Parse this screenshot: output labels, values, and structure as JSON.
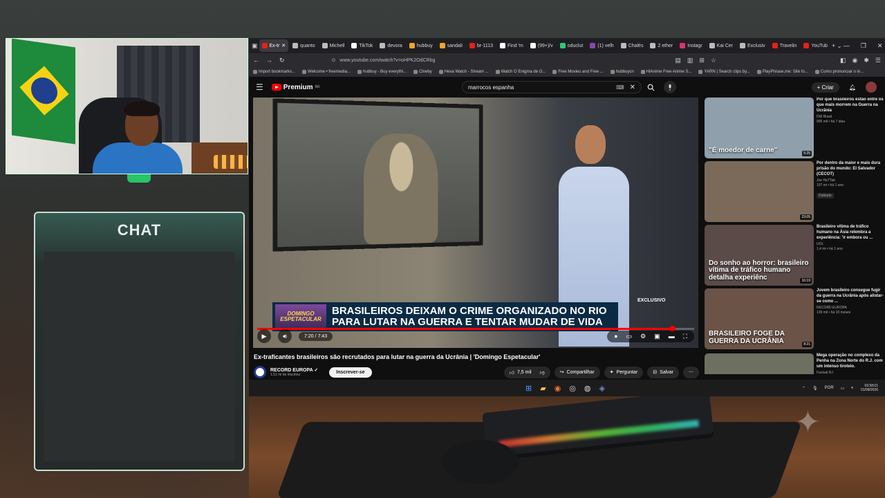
{
  "chat": {
    "title": "CHAT"
  },
  "browser": {
    "tabs": [
      {
        "label": "Ex-tr",
        "color": "#e62117",
        "active": true
      },
      {
        "label": "quanto",
        "color": "#bbbbbb"
      },
      {
        "label": "Michell",
        "color": "#bbbbbb"
      },
      {
        "label": "TikTok",
        "color": "#ffffff"
      },
      {
        "label": "devora",
        "color": "#bbbbbb"
      },
      {
        "label": "hubbuy",
        "color": "#f5a623"
      },
      {
        "label": "sandali",
        "color": "#f5a623"
      },
      {
        "label": "br-1113",
        "color": "#e62117"
      },
      {
        "label": "Find 'm",
        "color": "#ffffff"
      },
      {
        "label": "(99+)/v",
        "color": "#ffffff"
      },
      {
        "label": "oduclut",
        "color": "#2ecc71"
      },
      {
        "label": "(1) velh",
        "color": "#8e44ad"
      },
      {
        "label": "Chalés",
        "color": "#bbbbbb"
      },
      {
        "label": "2 ether",
        "color": "#bbbbbb"
      },
      {
        "label": "Instagr",
        "color": "#e1306c"
      },
      {
        "label": "Kai Cer",
        "color": "#bbbbbb"
      },
      {
        "label": "Exclusiv",
        "color": "#bbbbbb"
      },
      {
        "label": "Travelin",
        "color": "#e62117"
      },
      {
        "label": "YouTub",
        "color": "#e62117"
      }
    ],
    "url": "www.youtube.com/watch?v=oHPK2OdCRbg",
    "bookmarks": [
      "Import bookmarks...",
      "Welcome • freemedia...",
      "hubbuy - Buy everythi...",
      "Cineby",
      "Hexa Watch - Stream ...",
      "Watch O Enigma de O...",
      "Free Movies and Free ...",
      "hubbuycn",
      "HiAnime Free Anime S...",
      "YARN | Search clips by...",
      "PlayPhrase.me: Site fo...",
      "Como pronunciar o in..."
    ]
  },
  "youtube": {
    "logo_text": "Premium",
    "logo_sup": "BR",
    "search_value": "marrocos espanha",
    "create_label": "Criar",
    "video": {
      "banner_logo_line1": "DOMINGO",
      "banner_logo_line2": "ESPETACULAR",
      "banner_line1": "BRASILEIROS DEIXAM O CRIME ORGANIZADO NO RIO",
      "banner_line2": "PARA LUTAR NA GUERRA E TENTAR MUDAR DE VIDA",
      "exclusivo": "EXCLUSIVO",
      "time": "7:20 / 7:43",
      "progress": 0.95
    },
    "title": "Ex-traficantes brasileiros são recrutados para lutar na guerra da Ucrânia | 'Domingo Espetacular'",
    "channel": {
      "name": "RECORD EUROPA",
      "subs": "1,51 mi de inscritos"
    },
    "subscribe_label": "Inscrever-se",
    "actions": {
      "likes": "7,5 mil",
      "share": "Compartilhar",
      "ask": "Perguntar",
      "save": "Salvar"
    },
    "recommendations": [
      {
        "title": "Por que brasileiros estão entre os que mais morrem na Guerra na Ucrânia",
        "channel": "DW Brasil",
        "meta": "906 mil • há 7 dias",
        "duration": "5:25",
        "caption": "\"É moedor de carne\"",
        "thumb": "#8fa0ac"
      },
      {
        "title": "Por dentro da maior e mais dura prisão do mundo: El Salvador (CECOT)",
        "channel": "Joe HaTTab",
        "meta": "107 mi • há 1 ano",
        "duration": "23:05",
        "badge": "Dublado",
        "caption": "",
        "thumb": "#7b6a5a"
      },
      {
        "title": "Brasileiro vítima de tráfico humano na Ásia relembra a experiência: 'ir embora ou ...",
        "channel": "UOL",
        "meta": "1,4 mi • há 1 ano",
        "duration": "16:19",
        "caption": "Do sonho ao horror: brasileiro vítima de tráfico humano detalha experiênc",
        "thumb": "#5a4a48"
      },
      {
        "title": "Jovem brasileiro consegue fugir da guerra na Ucrânia após alistar-se como ...",
        "channel": "RECORD EUROPA",
        "meta": "139 mil • há 10 meses",
        "duration": "8:21",
        "caption": "BRASILEIRO FOGE DA GUERRA DA UCRÂNIA",
        "thumb": "#6b5348"
      },
      {
        "title": "Mega operação no complexo da Penha na Zona Norte do R.J. com um intenso tiroteio.",
        "channel": "Factual RJ",
        "meta": "",
        "duration": "",
        "caption": "",
        "thumb": "#6d7060"
      }
    ]
  },
  "taskbar": {
    "lang": "POR",
    "time": "03:58:01",
    "date": "01/08/2026"
  }
}
